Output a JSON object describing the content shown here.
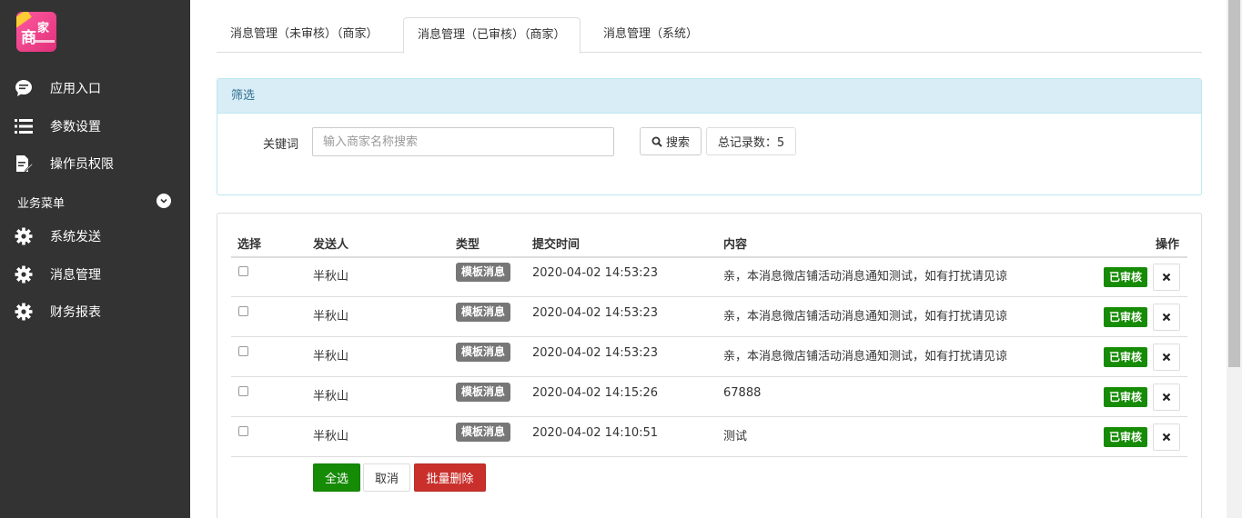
{
  "sidebar": {
    "logo_text_main": "商",
    "logo_text_sub": "家",
    "items": [
      {
        "label": "应用入口",
        "icon": "chat-bubble-icon"
      },
      {
        "label": "参数设置",
        "icon": "list-icon"
      },
      {
        "label": "操作员权限",
        "icon": "edit-document-icon"
      }
    ],
    "section_label": "业务菜单",
    "section_items": [
      {
        "label": "系统发送",
        "icon": "gear-icon"
      },
      {
        "label": "消息管理",
        "icon": "gear-icon"
      },
      {
        "label": "财务报表",
        "icon": "gear-icon"
      }
    ]
  },
  "tabs": [
    {
      "label": "消息管理（未审核）（商家）"
    },
    {
      "label": "消息管理（已审核）（商家）"
    },
    {
      "label": "消息管理（系统）"
    }
  ],
  "filter": {
    "title": "筛选",
    "keyword_label": "关键词",
    "keyword_placeholder": "输入商家名称搜索",
    "search_label": "搜索",
    "total_label": "总记录数：5"
  },
  "table": {
    "headers": {
      "select": "选择",
      "sender": "发送人",
      "type": "类型",
      "time": "提交时间",
      "content": "内容",
      "action": "操作"
    },
    "rows": [
      {
        "sender": "半秋山",
        "type": "模板消息",
        "time": "2020-04-02 14:53:23",
        "content": "亲，本消息微店铺活动消息通知测试，如有打扰请见谅",
        "status": "已审核"
      },
      {
        "sender": "半秋山",
        "type": "模板消息",
        "time": "2020-04-02 14:53:23",
        "content": "亲，本消息微店铺活动消息通知测试，如有打扰请见谅",
        "status": "已审核"
      },
      {
        "sender": "半秋山",
        "type": "模板消息",
        "time": "2020-04-02 14:53:23",
        "content": "亲，本消息微店铺活动消息通知测试，如有打扰请见谅",
        "status": "已审核"
      },
      {
        "sender": "半秋山",
        "type": "模板消息",
        "time": "2020-04-02 14:15:26",
        "content": "67888",
        "status": "已审核"
      },
      {
        "sender": "半秋山",
        "type": "模板消息",
        "time": "2020-04-02 14:10:51",
        "content": "测试",
        "status": "已审核"
      }
    ]
  },
  "actions": {
    "select_all": "全选",
    "cancel": "取消",
    "batch_delete": "批量删除"
  },
  "colors": {
    "sidebar_bg": "#333333",
    "success": "#168b06",
    "danger": "#c9302c",
    "panel_head": "#d9edf7"
  }
}
